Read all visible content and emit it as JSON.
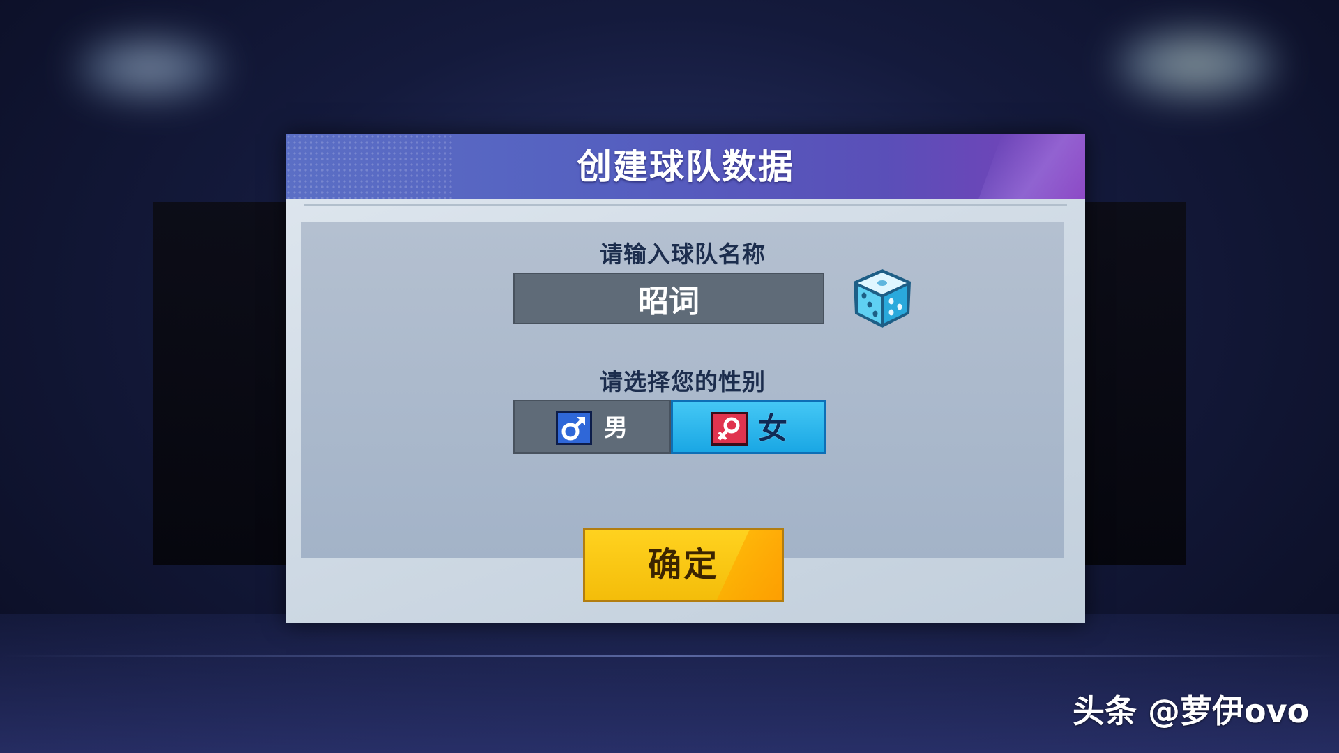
{
  "dialog": {
    "title": "创建球队数据"
  },
  "team_name": {
    "label": "请输入球队名称",
    "value": "昭词",
    "randomize_icon": "dice-icon"
  },
  "gender": {
    "label": "请选择您的性别",
    "options": [
      {
        "label": "男",
        "icon": "male-symbol-icon",
        "selected": false
      },
      {
        "label": "女",
        "icon": "female-symbol-icon",
        "selected": true
      }
    ]
  },
  "confirm": {
    "label": "确定"
  },
  "watermark": {
    "text": "头条 @萝伊ovo"
  },
  "colors": {
    "header": "#5560c0",
    "selected_option": "#1aa7e4",
    "confirm_button": "#f4bd0a"
  }
}
